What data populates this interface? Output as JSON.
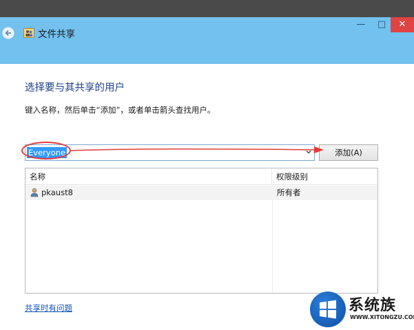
{
  "window": {
    "title": "文件共享",
    "minimize_glyph": "—",
    "maximize_glyph": "□",
    "close_glyph": "✕"
  },
  "main": {
    "heading": "选择要与其共享的用户",
    "instruction": "键入名称，然后单击“添加”，或者单击箭头查找用户。",
    "user_input": {
      "value": "Everyone"
    },
    "add_button_label": "添加(A)"
  },
  "table": {
    "columns": [
      "名称",
      "权限级别"
    ],
    "rows": [
      {
        "name": "pkaust8",
        "permission": "所有者"
      }
    ]
  },
  "footer": {
    "help_link": "共享时有问题"
  },
  "watermark": {
    "text": "系统族",
    "url": "WWW.XITONGZU.COM"
  },
  "colors": {
    "titlebar": "#72c1ef",
    "close": "#e04343",
    "heading": "#1b3f8b",
    "annotation": "#e23a3a"
  }
}
